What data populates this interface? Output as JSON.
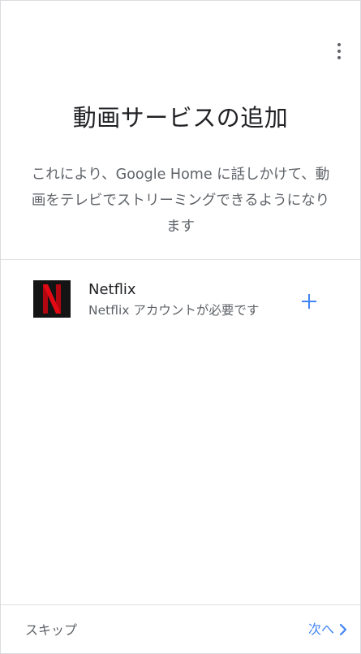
{
  "header": {
    "title": "動画サービスの追加",
    "description": "これにより、Google Home に話しかけて、動画をテレビでストリーミングできるようになります"
  },
  "services": [
    {
      "name": "Netflix",
      "description": "Netflix アカウントが必要です",
      "logo_letter": "N",
      "logo_color": "#e50914",
      "logo_background": "#141414"
    }
  ],
  "footer": {
    "skip_label": "スキップ",
    "next_label": "次へ"
  },
  "icons": {
    "menu": "more-vert-icon",
    "add": "plus-icon",
    "next": "chevron-right-icon"
  },
  "colors": {
    "accent": "#4285f4",
    "title_text": "#202124",
    "secondary_text": "#5f6368",
    "divider": "#e0e0e0"
  }
}
